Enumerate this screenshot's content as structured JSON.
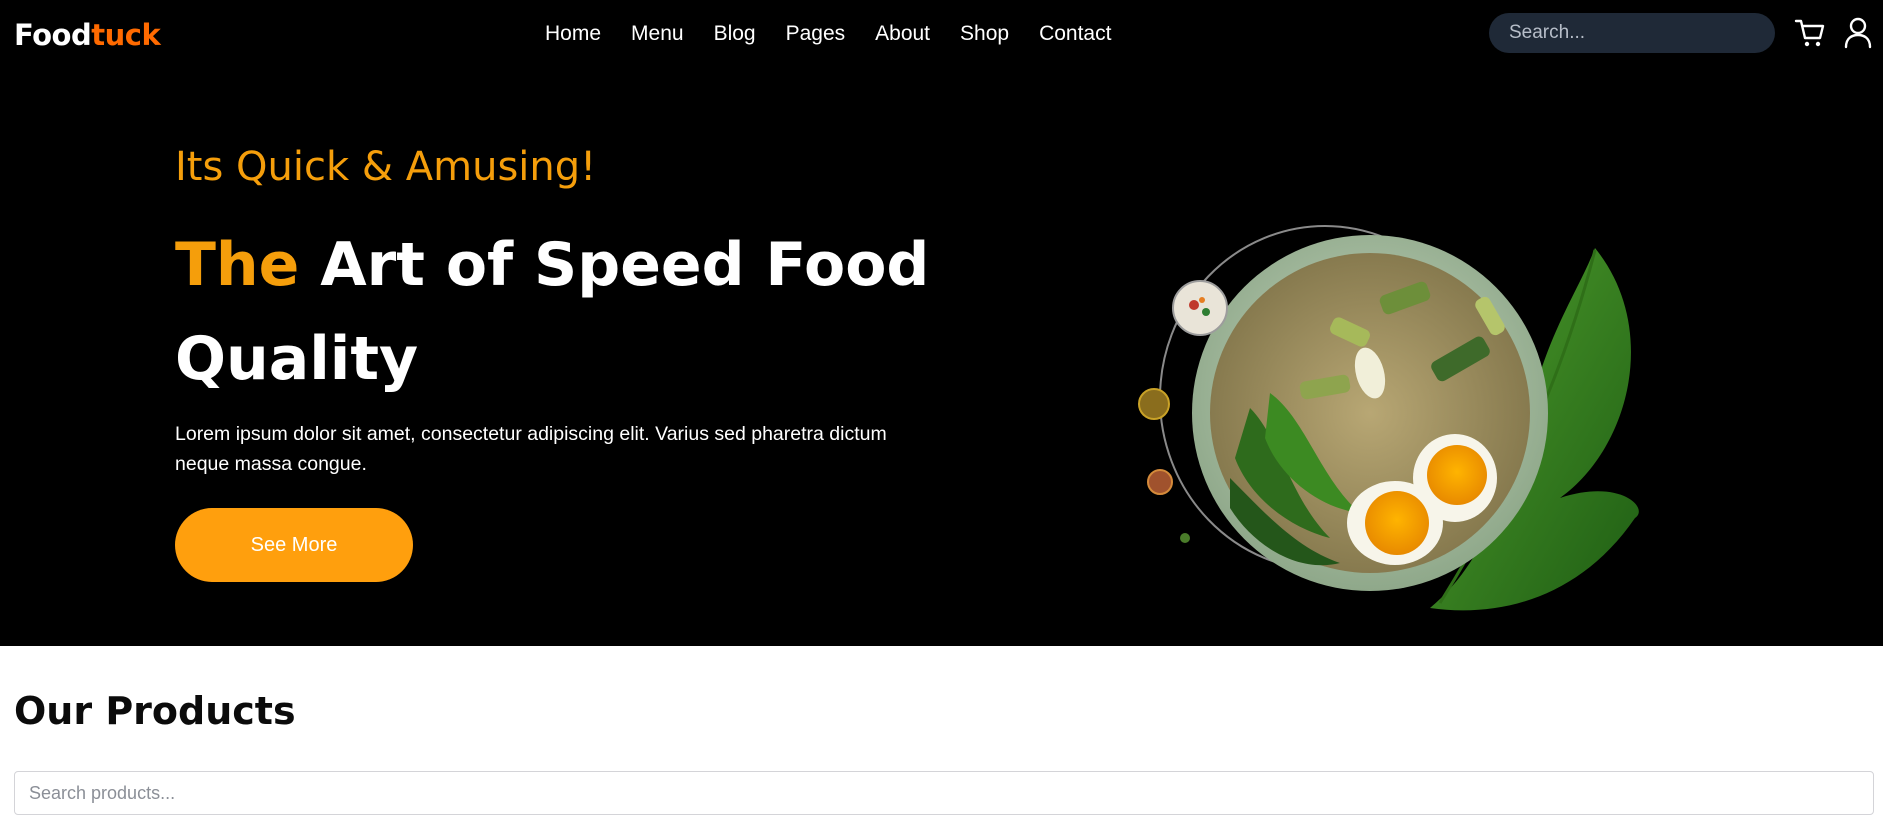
{
  "brand": {
    "part1": "Food",
    "part2": "tuck",
    "colors": {
      "part1": "#ffffff",
      "part2": "#ff6a00"
    }
  },
  "nav": {
    "items": [
      {
        "label": "Home"
      },
      {
        "label": "Menu"
      },
      {
        "label": "Blog"
      },
      {
        "label": "Pages"
      },
      {
        "label": "About"
      },
      {
        "label": "Shop"
      },
      {
        "label": "Contact"
      }
    ],
    "search_placeholder": "Search...",
    "icons": [
      "cart-icon",
      "user-icon"
    ]
  },
  "hero": {
    "kicker": "Its Quick & Amusing!",
    "title_accent": "The",
    "title_rest": "Art of Speed Food Quality",
    "description": "Lorem ipsum dolor sit amet, consectetur adipiscing elit. Varius sed pharetra dictum neque massa congue.",
    "cta_label": "See More",
    "image": "plate-of-rice-with-eggs-and-leaf"
  },
  "products": {
    "title": "Our Products",
    "search_placeholder": "Search products..."
  },
  "colors": {
    "background_dark": "#000000",
    "accent": "#ff9f0d",
    "kicker": "#f59e0b",
    "search_pill": "#1f2937"
  }
}
